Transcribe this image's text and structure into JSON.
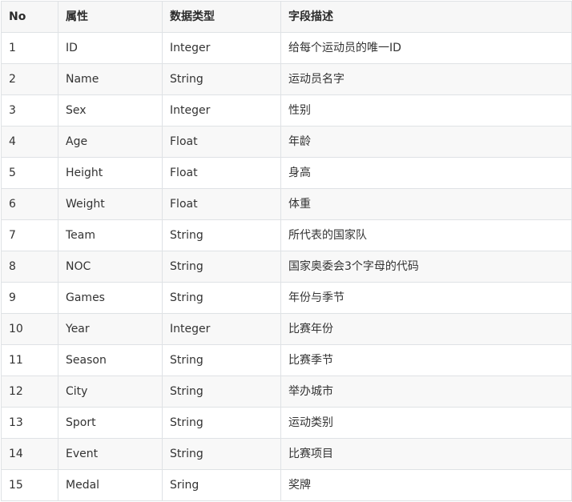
{
  "table": {
    "headers": [
      "No",
      "属性",
      "数据类型",
      "字段描述"
    ],
    "rows": [
      [
        "1",
        "ID",
        "Integer",
        "给每个运动员的唯一ID"
      ],
      [
        "2",
        "Name",
        "String",
        "运动员名字"
      ],
      [
        "3",
        "Sex",
        "Integer",
        "性别"
      ],
      [
        "4",
        "Age",
        "Float",
        "年龄"
      ],
      [
        "5",
        "Height",
        "Float",
        "身高"
      ],
      [
        "6",
        "Weight",
        "Float",
        "体重"
      ],
      [
        "7",
        "Team",
        "String",
        "所代表的国家队"
      ],
      [
        "8",
        "NOC",
        "String",
        "国家奥委会3个字母的代码"
      ],
      [
        "9",
        "Games",
        "String",
        "年份与季节"
      ],
      [
        "10",
        "Year",
        "Integer",
        "比赛年份"
      ],
      [
        "11",
        "Season",
        "String",
        "比赛季节"
      ],
      [
        "12",
        "City",
        "String",
        "举办城市"
      ],
      [
        "13",
        "Sport",
        "String",
        "运动类别"
      ],
      [
        "14",
        "Event",
        "String",
        "比赛项目"
      ],
      [
        "15",
        "Medal",
        "Sring",
        "奖牌"
      ]
    ]
  },
  "colors": {
    "border": "#dfe2e5",
    "header_bg": "#f7f7f7",
    "stripe_bg": "#f8f8f8",
    "text": "#333333"
  }
}
